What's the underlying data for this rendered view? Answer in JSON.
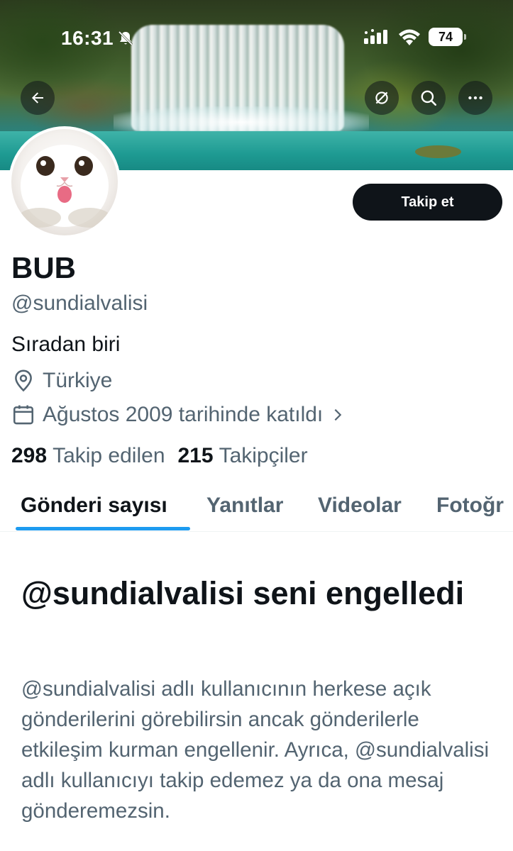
{
  "status_bar": {
    "time": "16:31",
    "battery": "74",
    "icons": [
      "bell-off-icon",
      "signal-icon",
      "wifi-icon",
      "battery-icon"
    ]
  },
  "header": {
    "icons": [
      "back-arrow-icon",
      "grok-icon",
      "search-icon",
      "more-icon"
    ]
  },
  "profile": {
    "follow_label": "Takip et",
    "display_name": "BUB",
    "handle": "@sundialvalisi",
    "bio": "Sıradan biri",
    "location": "Türkiye",
    "joined": "Ağustos 2009 tarihinde katıldı",
    "following_count": "298",
    "following_label": "Takip edilen",
    "followers_count": "215",
    "followers_label": "Takipçiler"
  },
  "tabs": [
    {
      "label": "Gönderi sayısı",
      "active": true
    },
    {
      "label": "Yanıtlar",
      "active": false
    },
    {
      "label": "Videolar",
      "active": false
    },
    {
      "label": "Fotoğr",
      "active": false
    }
  ],
  "blocked": {
    "title": "@sundialvalisi seni engelledi",
    "body": "@sundialvalisi adlı kullanıcının herkese açık gönderilerini görebilirsin ancak gönderilerle etkileşim kurman engellenir. Ayrıca, @sundialvalisi adlı kullanıcıyı takip edemez ya da ona mesaj gönderemezsin."
  },
  "colors": {
    "text_primary": "#0f1419",
    "text_secondary": "#536471",
    "accent": "#1d9bf0",
    "button_dark": "#0f1419"
  }
}
